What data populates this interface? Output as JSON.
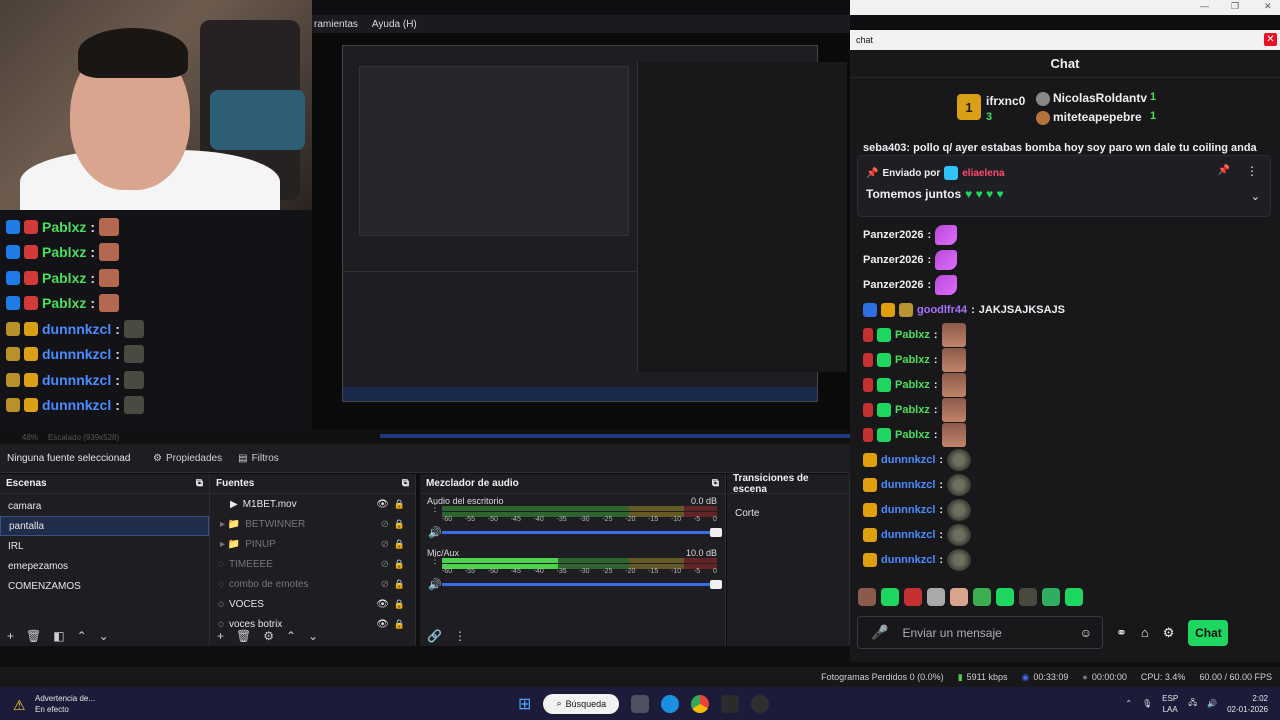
{
  "menubar": {
    "items": [
      "ramientas",
      "Ayuda (H)"
    ]
  },
  "overlay_chat": [
    {
      "user": "Pablxz",
      "sep": ":",
      "color": "green"
    },
    {
      "user": "Pablxz",
      "sep": ":",
      "color": "green"
    },
    {
      "user": "Pablxz",
      "sep": ":",
      "color": "green"
    },
    {
      "user": "Pablxz",
      "sep": ":",
      "color": "green"
    },
    {
      "user": "dunnnkzcl",
      "sep": ":",
      "color": "blue"
    },
    {
      "user": "dunnnkzcl",
      "sep": ":",
      "color": "blue"
    },
    {
      "user": "dunnnkzcl",
      "sep": ":",
      "color": "blue"
    },
    {
      "user": "dunnnkzcl",
      "sep": ":",
      "color": "blue"
    }
  ],
  "preview_status": {
    "zoom": "48%",
    "scale": "Escalado (939x528)"
  },
  "source_bar": {
    "selected_source": "Ninguna fuente seleccionad",
    "properties": "Propiedades",
    "filters": "Filtros"
  },
  "scenes": {
    "title": "Escenas",
    "items": [
      "camara",
      "pantalla",
      "IRL",
      "emepezamos",
      "COMENZAMOS"
    ],
    "selected": "pantalla"
  },
  "sources": {
    "title": "Fuentes",
    "items": [
      {
        "name": "M1BET.mov",
        "type": "media",
        "visible": true
      },
      {
        "name": "BETWINNER",
        "type": "folder",
        "visible": false
      },
      {
        "name": "PINUP",
        "type": "folder",
        "visible": false
      },
      {
        "name": "TIMEEEE",
        "type": "source",
        "visible": false
      },
      {
        "name": "combo de emotes",
        "type": "source",
        "visible": false
      },
      {
        "name": "VOCES",
        "type": "source",
        "visible": true
      },
      {
        "name": "voces botrix",
        "type": "source",
        "visible": true
      }
    ]
  },
  "mixer": {
    "title": "Mezclador de audio",
    "tracks": [
      {
        "name": "Audio del escritorio",
        "db": "0.0 dB",
        "level": 0.0
      },
      {
        "name": "Mic/Aux",
        "db": "10.0 dB",
        "level": 0.42
      }
    ],
    "scale": [
      "-60",
      "-55",
      "-50",
      "-45",
      "-40",
      "-35",
      "-30",
      "-25",
      "-20",
      "-15",
      "-10",
      "-5",
      "0"
    ]
  },
  "transitions": {
    "title": "Transiciones de escena",
    "current": "Corte"
  },
  "obs_status": {
    "dropped": "Fotogramas Perdidos 0 (0.0%)",
    "bitrate": "5911 kbps",
    "stream_time": "00:33:09",
    "rec_time": "00:00:00",
    "cpu": "CPU: 3.4%",
    "fps": "60.00 / 60.00 FPS"
  },
  "chat_window": {
    "title": "chat",
    "header": "Chat",
    "leaderboard": [
      {
        "rank": "1",
        "name": "ifrxnc0",
        "count": "3"
      },
      {
        "rank": "",
        "name": "NicolasRoldantv",
        "count": "1"
      },
      {
        "rank": "",
        "name": "miteteарepebre",
        "count": "1"
      }
    ],
    "partial_message": "seba403: pollo q/ ayer estabas bomba hoy soy paro wn dale tu coiling anda",
    "pinned": {
      "label": "Enviado por",
      "user": "eliaelena",
      "message": "Tomemos juntos"
    },
    "messages": [
      {
        "user": "Panzer2026",
        "text": "",
        "kind": "purple"
      },
      {
        "user": "Panzer2026",
        "text": "",
        "kind": "purple"
      },
      {
        "user": "Panzer2026",
        "text": "",
        "kind": "purple"
      },
      {
        "user": "goodlfr44",
        "text": "JAKJSAJKSAJS",
        "kind": "text"
      },
      {
        "user": "Pablxz",
        "text": "",
        "kind": "face"
      },
      {
        "user": "Pablxz",
        "text": "",
        "kind": "face"
      },
      {
        "user": "Pablxz",
        "text": "",
        "kind": "face"
      },
      {
        "user": "Pablxz",
        "text": "",
        "kind": "face"
      },
      {
        "user": "Pablxz",
        "text": "",
        "kind": "face"
      },
      {
        "user": "dunnnkzcl",
        "text": "",
        "kind": "grey"
      },
      {
        "user": "dunnnkzcl",
        "text": "",
        "kind": "grey"
      },
      {
        "user": "dunnnkzcl",
        "text": "",
        "kind": "grey"
      },
      {
        "user": "dunnnkzcl",
        "text": "",
        "kind": "grey"
      },
      {
        "user": "dunnnkzcl",
        "text": "",
        "kind": "grey"
      }
    ],
    "input_placeholder": "Enviar un mensaje",
    "send_label": "Chat"
  },
  "taskbar": {
    "warning_title": "Advertencia de...",
    "warning_sub": "En efecto",
    "search": "Búsqueda",
    "lang1": "ESP",
    "lang2": "LAA",
    "time": "2:02",
    "date": "02-01-2026"
  },
  "colors": {
    "accent_green": "#1ed760",
    "selection": "#1f2c4a",
    "taskbar": "#1c1c3a"
  }
}
